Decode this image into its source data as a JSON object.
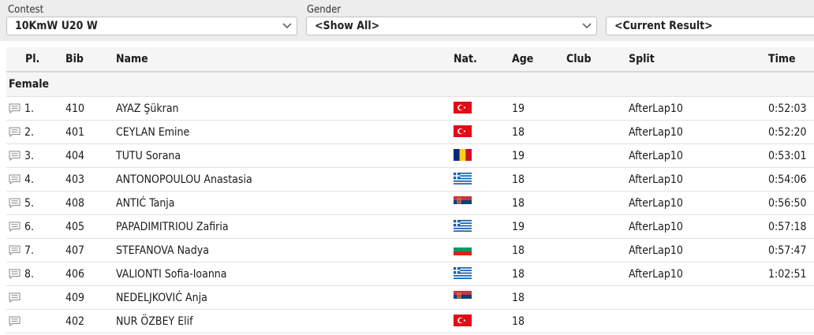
{
  "filters": {
    "contest_label": "Contest",
    "contest_value": "10KmW U20 W",
    "gender_label": "Gender",
    "gender_value": "<Show All>",
    "result_value": "<Current Result>"
  },
  "table": {
    "headers": {
      "pl": "Pl.",
      "bib": "Bib",
      "name": "Name",
      "nat": "Nat.",
      "age": "Age",
      "club": "Club",
      "split": "Split",
      "time": "Time"
    },
    "group": "Female",
    "rows": [
      {
        "place": "1.",
        "bib": "410",
        "name": "AYAZ Şükran",
        "nat": "TUR",
        "age": "19",
        "club": "",
        "split": "AfterLap10",
        "time": "0:52:03"
      },
      {
        "place": "2.",
        "bib": "401",
        "name": "CEYLAN Emine",
        "nat": "TUR",
        "age": "18",
        "club": "",
        "split": "AfterLap10",
        "time": "0:52:20"
      },
      {
        "place": "3.",
        "bib": "404",
        "name": "TUTU Sorana",
        "nat": "ROU",
        "age": "19",
        "club": "",
        "split": "AfterLap10",
        "time": "0:53:01"
      },
      {
        "place": "4.",
        "bib": "403",
        "name": "ANTONOPOULOU Anastasia",
        "nat": "GRE",
        "age": "18",
        "club": "",
        "split": "AfterLap10",
        "time": "0:54:06"
      },
      {
        "place": "5.",
        "bib": "408",
        "name": "ANTIĆ Tanja",
        "nat": "SRB",
        "age": "18",
        "club": "",
        "split": "AfterLap10",
        "time": "0:56:50"
      },
      {
        "place": "6.",
        "bib": "405",
        "name": "PAPADIMITRIOU Zafiria",
        "nat": "GRE",
        "age": "19",
        "club": "",
        "split": "AfterLap10",
        "time": "0:57:18"
      },
      {
        "place": "7.",
        "bib": "407",
        "name": "STEFANOVA Nadya",
        "nat": "BUL",
        "age": "18",
        "club": "",
        "split": "AfterLap10",
        "time": "0:57:47"
      },
      {
        "place": "8.",
        "bib": "406",
        "name": "VALIONTI Sofia-Ioanna",
        "nat": "GRE",
        "age": "18",
        "club": "",
        "split": "AfterLap10",
        "time": "1:02:51"
      },
      {
        "place": "",
        "bib": "409",
        "name": "NEDELJKOVIĆ Anja",
        "nat": "SRB",
        "age": "18",
        "club": "",
        "split": "",
        "time": ""
      },
      {
        "place": "",
        "bib": "402",
        "name": "NUR ÖZBEY Elif",
        "nat": "TUR",
        "age": "18",
        "club": "",
        "split": "",
        "time": ""
      }
    ]
  },
  "icons": {
    "comment": "comment-icon",
    "dropdown": "chevron-down-icon"
  },
  "colors": {
    "filter_bar": "#ededed",
    "header_bg": "#f5f5f5",
    "border": "#e1e1e1"
  }
}
